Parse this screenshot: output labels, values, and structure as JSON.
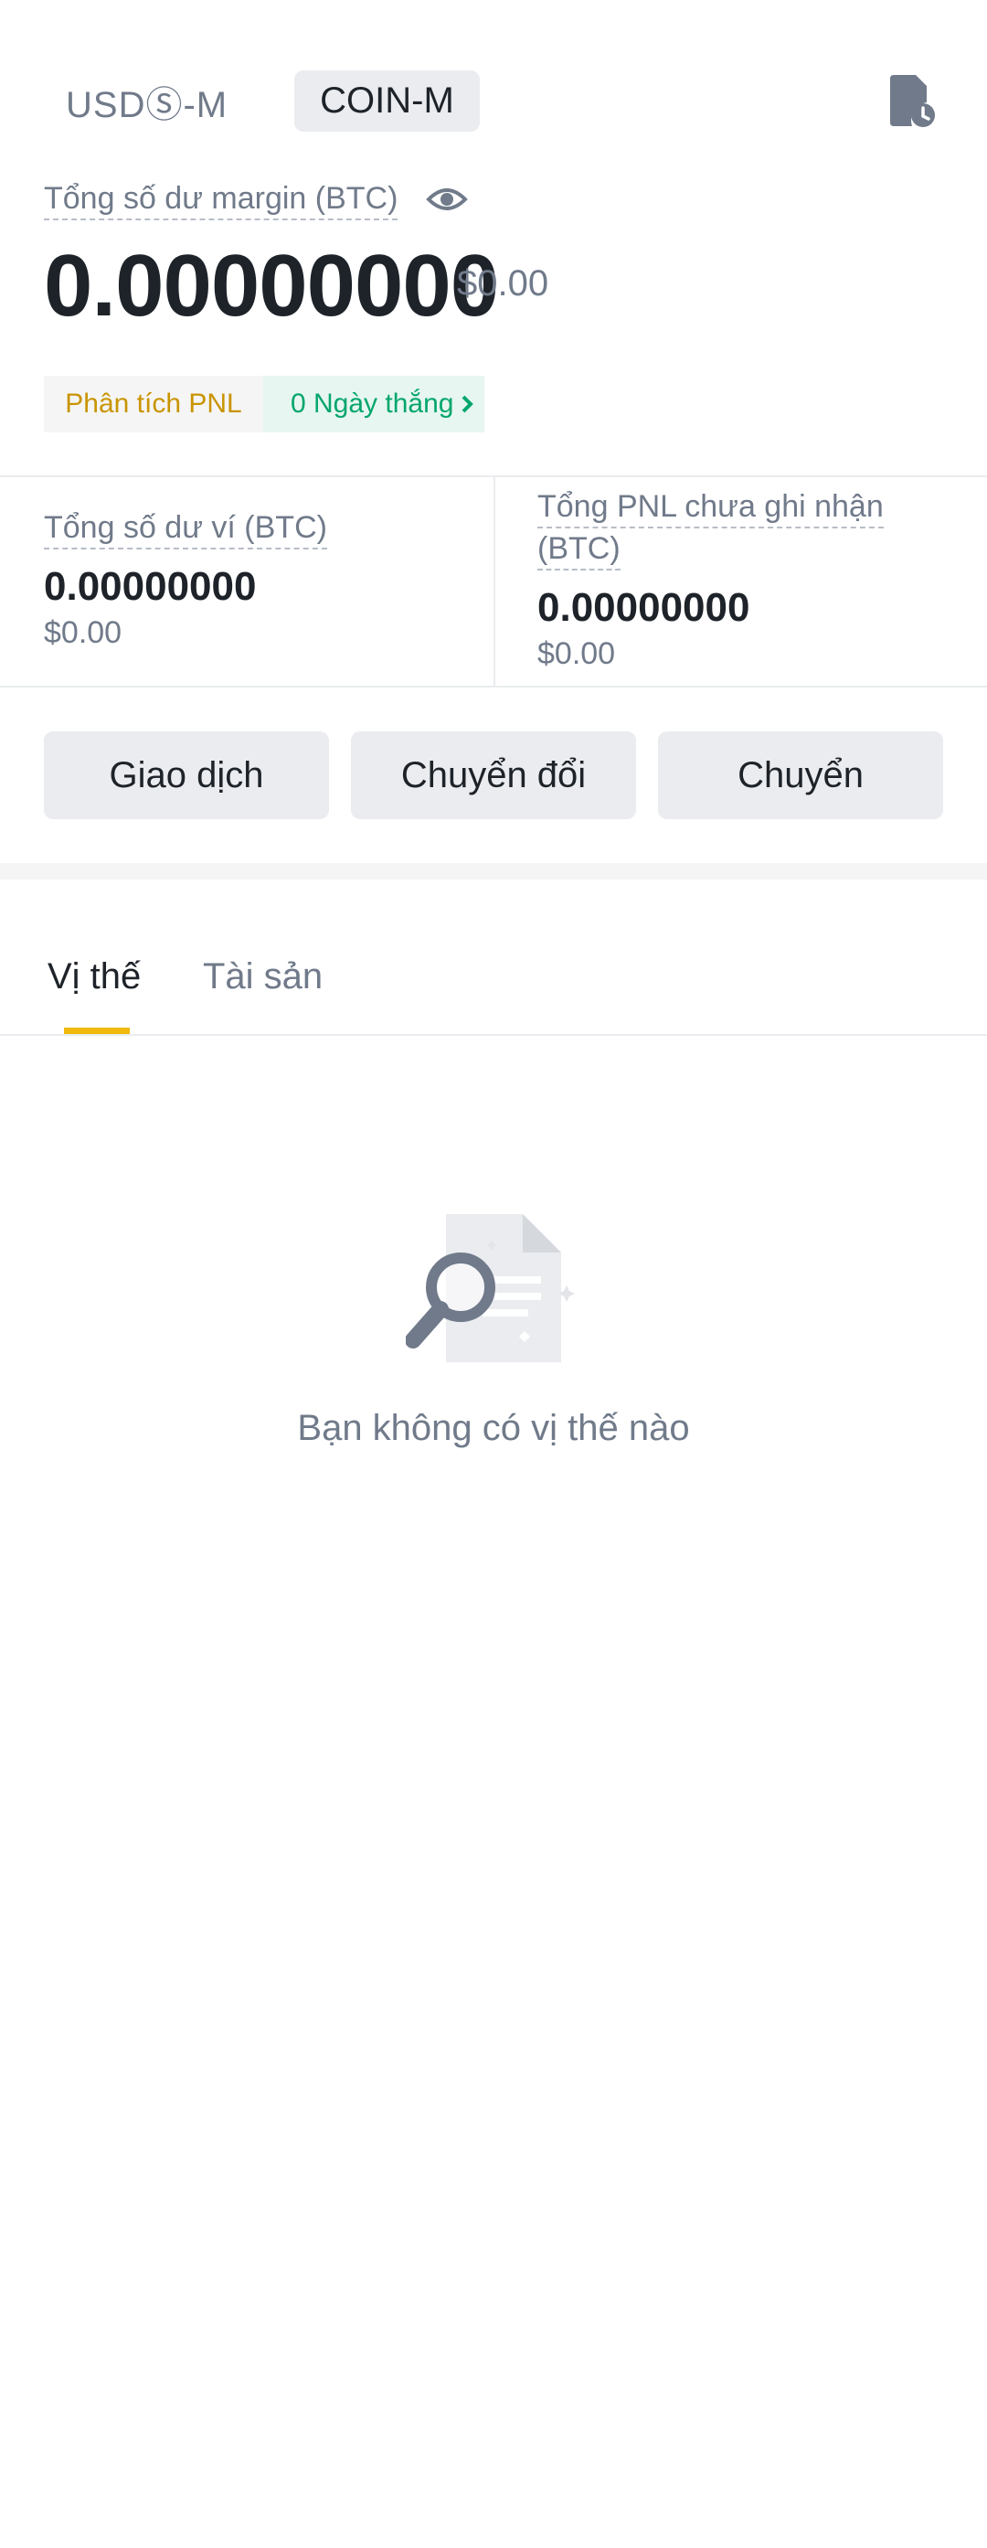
{
  "header": {
    "tab_usds": "USDⓈ-M",
    "tab_coin": "COIN-M",
    "history_icon": "history-document-icon"
  },
  "margin": {
    "label": "Tổng số dư margin (BTC)",
    "value": "0.00000000",
    "usd": "$0.00",
    "eye_icon": "eye-icon"
  },
  "pnl": {
    "analysis_label": "Phân tích PNL",
    "days_label": "0 Ngày thắng"
  },
  "wallet": {
    "label": "Tổng số dư ví (BTC)",
    "value": "0.00000000",
    "usd": "$0.00"
  },
  "unrealized": {
    "label_line1": "Tổng PNL chưa ghi nhận",
    "label_line2": "(BTC)",
    "value": "0.00000000",
    "usd": "$0.00"
  },
  "actions": {
    "trade": "Giao dịch",
    "convert": "Chuyển đổi",
    "transfer": "Chuyển"
  },
  "tabs": {
    "positions": "Vị thế",
    "assets": "Tài sản",
    "active": "positions"
  },
  "empty": {
    "message": "Bạn không có vị thế nào",
    "icon": "magnifier-document-icon"
  },
  "colors": {
    "accent": "#f0b90b",
    "pnl_orange": "#c99400",
    "win_green": "#03a66d",
    "muted": "#707a8a",
    "text": "#1e2329"
  }
}
